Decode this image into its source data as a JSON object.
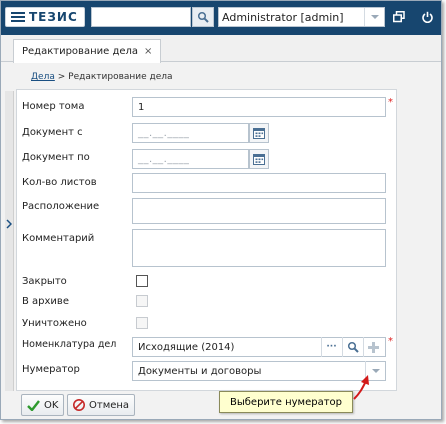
{
  "header": {
    "logo_text": "ТЕЗИС",
    "search_value": "",
    "user_select_value": "Administrator [admin]"
  },
  "tabs": [
    {
      "label": "Редактирование дела",
      "close": "×"
    }
  ],
  "breadcrumb": {
    "link": "Дела",
    "separator": ">",
    "current": "Редактирование дела"
  },
  "form": {
    "volume_number": {
      "label": "Номер тома",
      "value": "1",
      "required": "*"
    },
    "doc_from": {
      "label": "Документ с",
      "placeholder": "__.__.____"
    },
    "doc_to": {
      "label": "Документ по",
      "placeholder": "__.__.____"
    },
    "sheet_count": {
      "label": "Кол-во листов",
      "value": ""
    },
    "location": {
      "label": "Расположение",
      "value": ""
    },
    "comment": {
      "label": "Комментарий",
      "value": ""
    },
    "closed": {
      "label": "Закрыто"
    },
    "archived": {
      "label": "В архиве"
    },
    "destroyed": {
      "label": "Уничтожено"
    },
    "nomenclature": {
      "label": "Номенклатура дел",
      "value": "Исходящие (2014)",
      "required": "*",
      "more": "···"
    },
    "numerator": {
      "label": "Нумератор",
      "value": "Документы и договоры"
    }
  },
  "buttons": {
    "ok": "OK",
    "cancel": "Отмена"
  },
  "tooltip": {
    "text": "Выберите нумератор"
  },
  "colors": {
    "header_bg": "#17466f",
    "ok_icon": "#2e9a2e",
    "cancel_icon": "#c62a2a",
    "required": "#dd2222",
    "tooltip_bg": "#ffffcf",
    "tooltip_arrow": "#d21a1a"
  },
  "icons": {
    "menu": "hamburger-icon",
    "search": "magnifier-icon",
    "dropdown": "chevron-down-icon",
    "window": "window-restore-icon",
    "power": "power-icon",
    "calendar": "calendar-icon",
    "add": "plus-icon",
    "ok": "checkmark-icon",
    "cancel": "no-entry-icon"
  }
}
